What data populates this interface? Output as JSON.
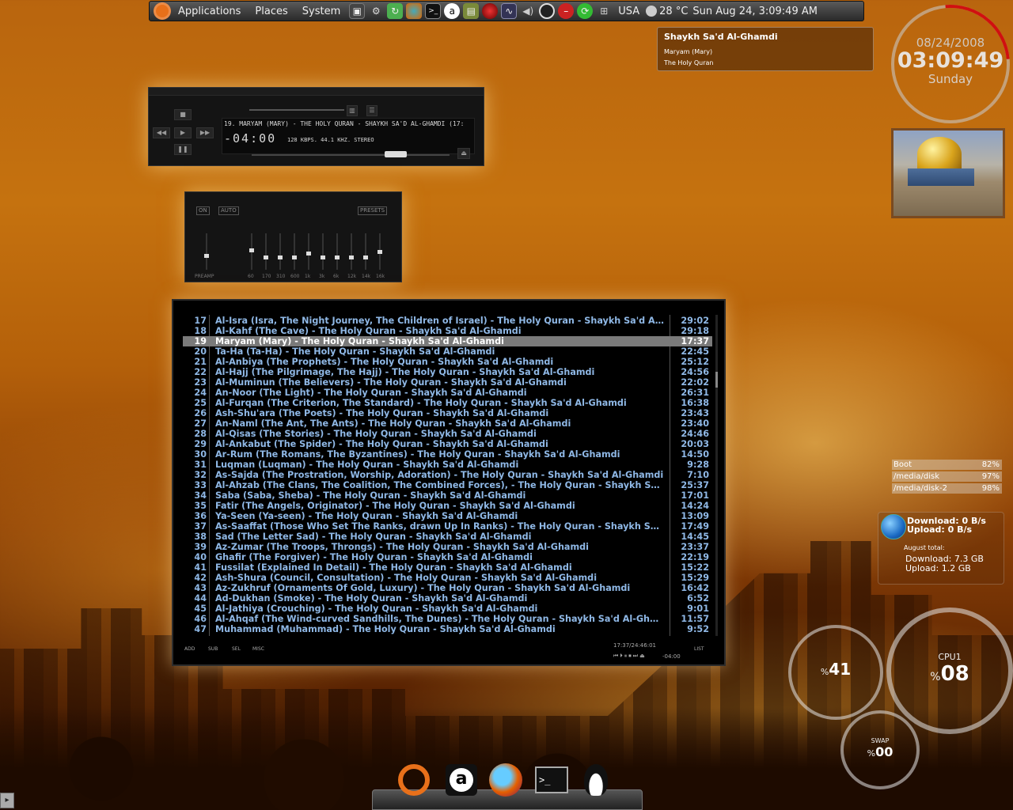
{
  "panel": {
    "menus": [
      "Applications",
      "Places",
      "System"
    ],
    "keyboard": "USA",
    "temperature": "28 °C",
    "datetime": "Sun Aug 24,  3:09:49 AM"
  },
  "notification": {
    "title": "Shaykh Sa'd Al-Ghamdi",
    "line1": "Maryam (Mary)",
    "line2": "The Holy Quran"
  },
  "clock": {
    "date": "08/24/2008",
    "time": "03:09:49",
    "weekday": "Sunday"
  },
  "player": {
    "track": "19. MARYAM (MARY) - THE HOLY QURAN - SHAYKH SA'D AL-GHAMDI  (17:",
    "time": "-04:00",
    "info": "128 KBPS. 44.1 KHZ. STEREO"
  },
  "equalizer": {
    "on_label": "ON",
    "auto_label": "AUTO",
    "presets_label": "PRESETS",
    "preamp_label": "PREAMP",
    "preamp_level": 0.4,
    "bands": [
      {
        "label": "60",
        "level": 0.55
      },
      {
        "label": "170",
        "level": 0.35
      },
      {
        "label": "310",
        "level": 0.35
      },
      {
        "label": "600",
        "level": 0.35
      },
      {
        "label": "1k",
        "level": 0.45
      },
      {
        "label": "3k",
        "level": 0.35
      },
      {
        "label": "6k",
        "level": 0.35
      },
      {
        "label": "12k",
        "level": 0.35
      },
      {
        "label": "14k",
        "level": 0.35
      },
      {
        "label": "16k",
        "level": 0.5
      }
    ]
  },
  "playlist": {
    "selected_index": 19,
    "rows": [
      {
        "n": "17",
        "title": "Al-Isra (Isra, The Night Journey, The Children of Israel) - The Holy Quran - Shaykh Sa'd Al-Ghamdi",
        "dur": "29:02"
      },
      {
        "n": "18",
        "title": "Al-Kahf (The Cave) - The Holy Quran - Shaykh Sa'd Al-Ghamdi",
        "dur": "29:18"
      },
      {
        "n": "19",
        "title": "Maryam (Mary) - The Holy Quran - Shaykh Sa'd Al-Ghamdi",
        "dur": "17:37"
      },
      {
        "n": "20",
        "title": "Ta-Ha (Ta-Ha) - The Holy Quran - Shaykh Sa'd Al-Ghamdi",
        "dur": "22:45"
      },
      {
        "n": "21",
        "title": "Al-Anbiya (The Prophets) - The Holy Quran - Shaykh Sa'd Al-Ghamdi",
        "dur": "25:12"
      },
      {
        "n": "22",
        "title": "Al-Hajj (The Pilgrimage, The Hajj) - The Holy Quran - Shaykh Sa'd Al-Ghamdi",
        "dur": "24:56"
      },
      {
        "n": "23",
        "title": "Al-Muminun (The Believers) - The Holy Quran - Shaykh Sa'd Al-Ghamdi",
        "dur": "22:02"
      },
      {
        "n": "24",
        "title": "An-Noor (The Light) - The Holy Quran - Shaykh Sa'd Al-Ghamdi",
        "dur": "26:31"
      },
      {
        "n": "25",
        "title": "Al-Furqan (The Criterion, The Standard) - The Holy Quran - Shaykh Sa'd Al-Ghamdi",
        "dur": "16:38"
      },
      {
        "n": "26",
        "title": "Ash-Shu'ara (The Poets) - The Holy Quran - Shaykh Sa'd Al-Ghamdi",
        "dur": "23:43"
      },
      {
        "n": "27",
        "title": "An-Naml (The Ant, The Ants) - The Holy Quran - Shaykh Sa'd Al-Ghamdi",
        "dur": "23:40"
      },
      {
        "n": "28",
        "title": "Al-Qisas (The Stories) - The Holy Quran - Shaykh Sa'd Al-Ghamdi",
        "dur": "24:46"
      },
      {
        "n": "29",
        "title": "Al-Ankabut (The Spider) - The Holy Quran - Shaykh Sa'd Al-Ghamdi",
        "dur": "20:03"
      },
      {
        "n": "30",
        "title": "Ar-Rum (The Romans, The Byzantines) - The Holy Quran - Shaykh Sa'd Al-Ghamdi",
        "dur": "14:50"
      },
      {
        "n": "31",
        "title": "Luqman (Luqman) - The Holy Quran - Shaykh Sa'd Al-Ghamdi",
        "dur": "9:28"
      },
      {
        "n": "32",
        "title": "As-Sajda (The Prostration, Worship, Adoration) - The Holy Quran - Shaykh Sa'd Al-Ghamdi",
        "dur": "7:10"
      },
      {
        "n": "33",
        "title": "Al-Ahzab (The Clans, The Coalition, The Combined Forces), - The Holy Quran - Shaykh Sa'd Al-Ghamdi",
        "dur": "25:37"
      },
      {
        "n": "34",
        "title": "Saba (Saba, Sheba) - The Holy Quran - Shaykh Sa'd Al-Ghamdi",
        "dur": "17:01"
      },
      {
        "n": "35",
        "title": "Fatir (The Angels, Originator) - The Holy Quran - Shaykh Sa'd Al-Ghamdi",
        "dur": "14:24"
      },
      {
        "n": "36",
        "title": "Ya-Seen (Ya-seen) - The Holy Quran - Shaykh Sa'd Al-Ghamdi",
        "dur": "13:09"
      },
      {
        "n": "37",
        "title": "As-Saaffat (Those Who Set The Ranks, drawn Up In Ranks) - The Holy Quran - Shaykh Sa'd Al-Ghamdi",
        "dur": "17:49"
      },
      {
        "n": "38",
        "title": "Sad (The Letter Sad) - The Holy Quran - Shaykh Sa'd Al-Ghamdi",
        "dur": "14:45"
      },
      {
        "n": "39",
        "title": "Az-Zumar (The Troops, Throngs) - The Holy Quran - Shaykh Sa'd Al-Ghamdi",
        "dur": "23:37"
      },
      {
        "n": "40",
        "title": "Ghafir (The Forgiver) - The Holy Quran - Shaykh Sa'd Al-Ghamdi",
        "dur": "22:19"
      },
      {
        "n": "41",
        "title": "Fussilat (Explained In Detail) - The Holy Quran - Shaykh Sa'd Al-Ghamdi",
        "dur": "15:22"
      },
      {
        "n": "42",
        "title": "Ash-Shura (Council, Consultation) - The Holy Quran - Shaykh Sa'd Al-Ghamdi",
        "dur": "15:29"
      },
      {
        "n": "43",
        "title": "Az-Zukhruf (Ornaments Of Gold, Luxury) - The Holy Quran - Shaykh Sa'd Al-Ghamdi",
        "dur": "16:42"
      },
      {
        "n": "44",
        "title": "Ad-Dukhan (Smoke) - The Holy Quran - Shaykh Sa'd Al-Ghamdi",
        "dur": "6:52"
      },
      {
        "n": "45",
        "title": "Al-Jathiya (Crouching) - The Holy Quran - Shaykh Sa'd Al-Ghamdi",
        "dur": "9:01"
      },
      {
        "n": "46",
        "title": "Al-Ahqaf (The Wind-curved Sandhills, The Dunes) - The Holy Quran - Shaykh Sa'd Al-Ghamdi",
        "dur": "11:57"
      },
      {
        "n": "47",
        "title": "Muhammad (Muhammad) - The Holy Quran - Shaykh Sa'd Al-Ghamdi",
        "dur": "9:52"
      }
    ],
    "footer": {
      "add": "ADD",
      "sub": "SUB",
      "sel": "SEL",
      "misc": "MISC",
      "total": "17:37/24:46:01",
      "time": "-04:00",
      "list": "LIST"
    }
  },
  "disks": [
    {
      "name": "Boot",
      "pct": "82%"
    },
    {
      "name": "/media/disk",
      "pct": "97%"
    },
    {
      "name": "/media/disk-2",
      "pct": "98%"
    }
  ],
  "network": {
    "download": "Download: 0 B/s",
    "upload": "Upload: 0 B/s",
    "month_title": "August total:",
    "month_download": "Download: 7.3 GB",
    "month_upload": "Upload: 1.2 GB"
  },
  "gauges": {
    "ram_value": "41",
    "cpu_label": "CPU1",
    "cpu_value": "08",
    "swap_label": "SWAP",
    "swap_value": "00",
    "percent_sign": "%"
  },
  "icons": {
    "panel": [
      "ubuntu-logo-icon",
      "usb-icon",
      "gear-icon",
      "update-icon",
      "firefox-icon",
      "terminal-icon",
      "amarok-icon",
      "book-icon",
      "ladybug-icon",
      "monitor-icon",
      "volume-icon",
      "record-icon",
      "stop-icon",
      "refresh-icon",
      "network-icon",
      "weather-icon"
    ],
    "dock": [
      "ubuntu-logo-icon",
      "amarok-icon",
      "firefox-icon",
      "terminal-icon",
      "tux-icon"
    ]
  },
  "colors": {
    "playlist_text": "#8fb8e6",
    "playlist_selected": "#7a7a7a",
    "clock_arc": "#d01010"
  }
}
